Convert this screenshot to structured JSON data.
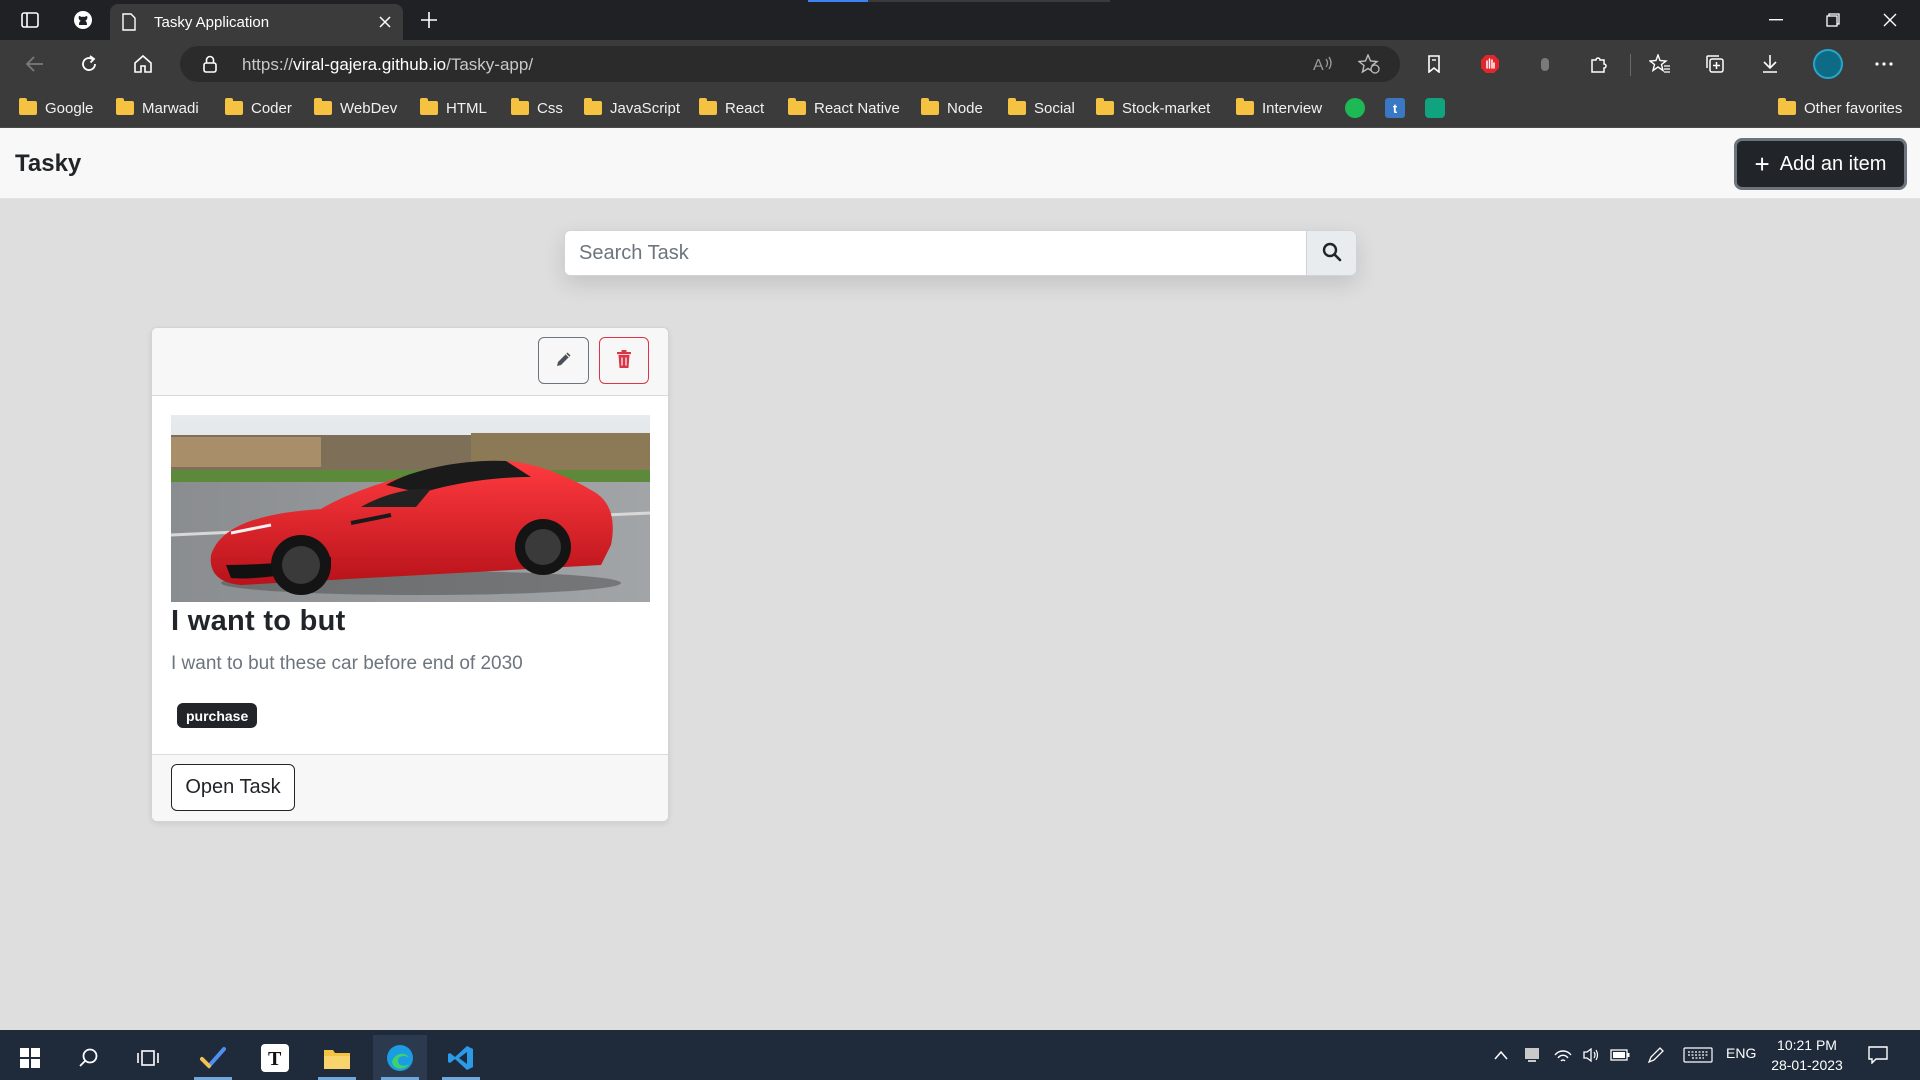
{
  "browser": {
    "tab_title": "Tasky Application",
    "url_prefix": "https://",
    "url_host": "viral-gajera.github.io",
    "url_path": "/Tasky-app/",
    "bookmarks": [
      "Google",
      "Marwadi",
      "Coder",
      "WebDev",
      "HTML",
      "Css",
      "JavaScript",
      "React",
      "React Native",
      "Node",
      "Social",
      "Stock-market",
      "Interview"
    ],
    "other_favorites": "Other favorites"
  },
  "app": {
    "brand": "Tasky",
    "add_button": "Add an item",
    "add_button_icon": "plus-icon",
    "search_placeholder": "Search Task",
    "search_value": ""
  },
  "tasks": [
    {
      "image_description_icon": "red-sports-car-image",
      "title": "I want to but",
      "description": "I want to but these car before end of 2030",
      "tag": "purchase",
      "open_button": "Open Task"
    }
  ],
  "taskbar": {
    "language": "ENG",
    "time": "10:21 PM",
    "date": "28-01-2023"
  },
  "colors": {
    "primary_dark": "#212529",
    "danger": "#dc3545",
    "page_background": "#dedede"
  }
}
